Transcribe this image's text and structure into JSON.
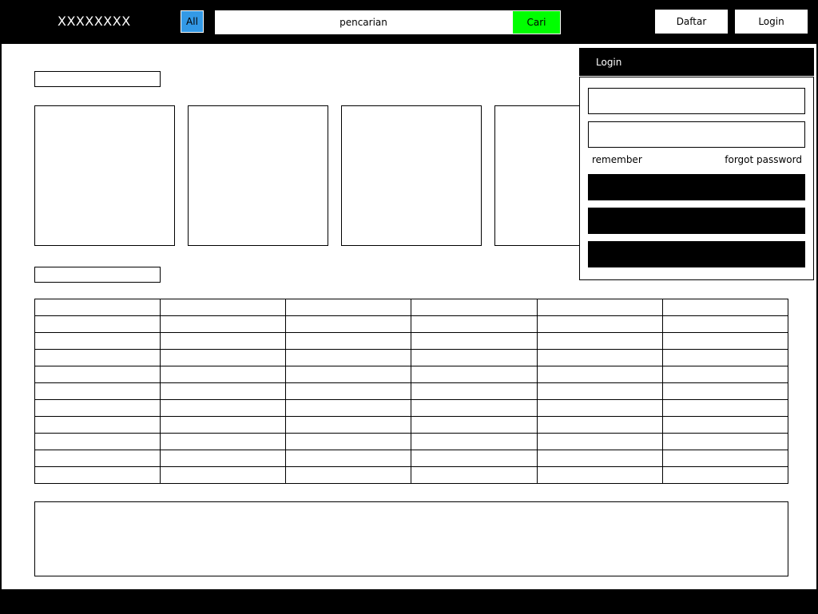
{
  "header": {
    "logo": "XXXXXXXX",
    "category_label": "All",
    "search_placeholder": "pencarian",
    "search_button": "Cari",
    "register_button": "Daftar",
    "login_button": "Login"
  },
  "colors": {
    "bar": "#000000",
    "category_button": "#3399e6",
    "search_button": "#00ff00",
    "content": "#ffffff"
  },
  "login_panel": {
    "title": "Login",
    "remember_label": "remember",
    "forgot_label": "forgot password"
  }
}
